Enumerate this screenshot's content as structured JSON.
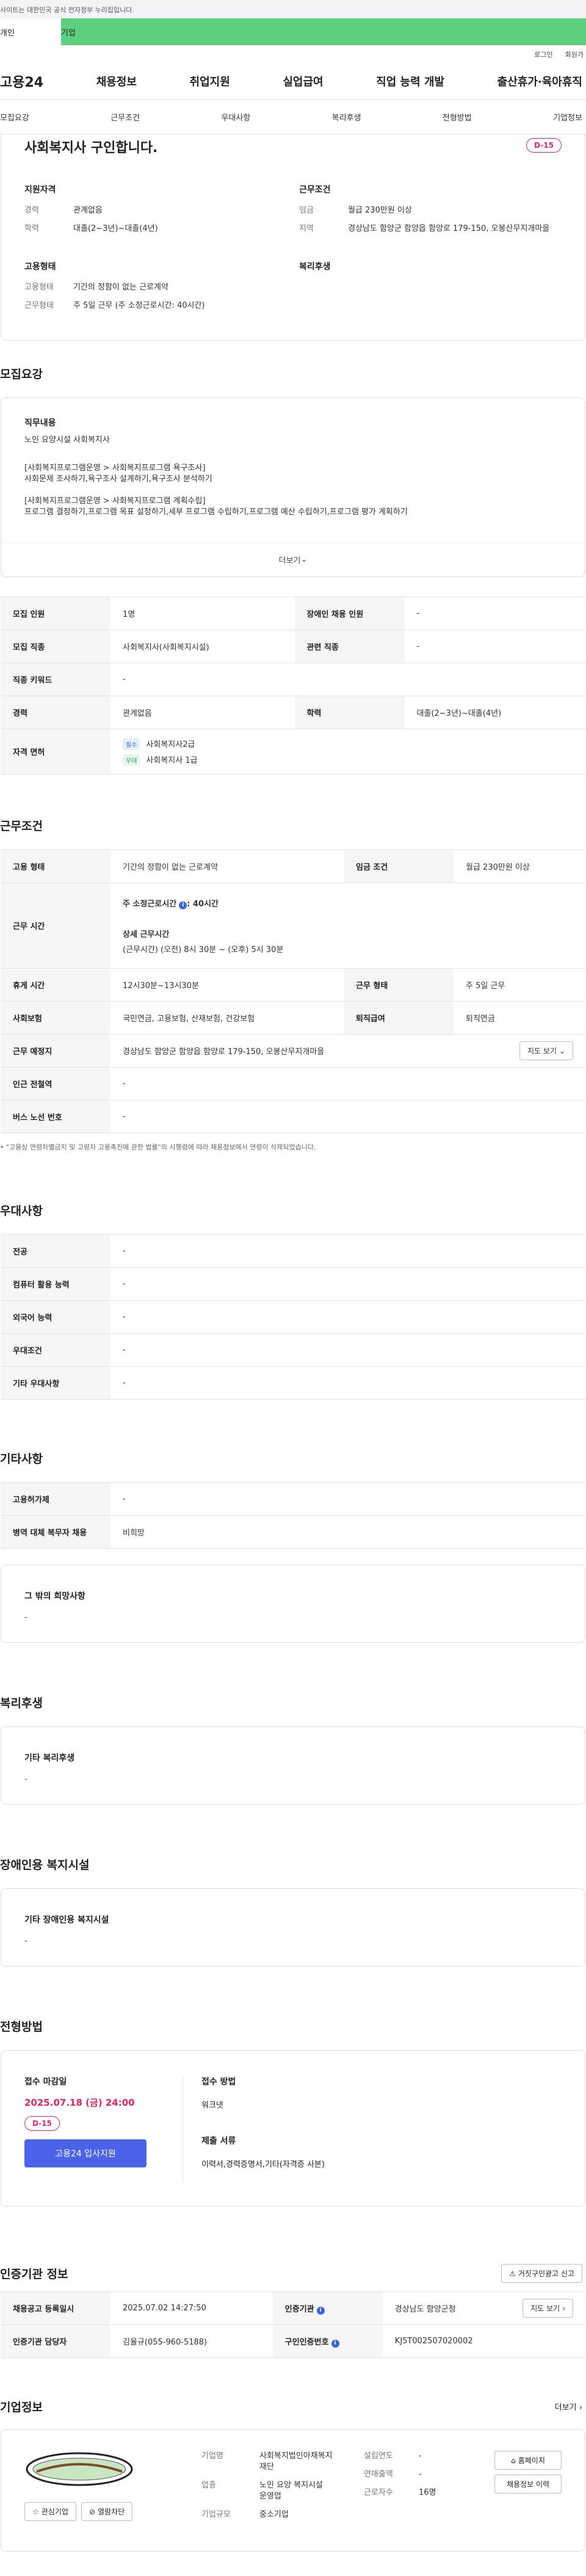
{
  "gov_banner": {
    "text": "사이트는 대한민국 공식 전자정부 누리집입니다."
  },
  "roles": {
    "personal": "개인",
    "business": "기업"
  },
  "util": {
    "login": "로그인",
    "join": "회원가"
  },
  "gnb": {
    "logo": "고용24",
    "menu": [
      "채용정보",
      "취업지원",
      "실업급여",
      "직업 능력 개발",
      "출산휴가·육아휴직"
    ]
  },
  "subnav": [
    "모집요강",
    "근무조건",
    "우대사항",
    "복리후생",
    "전형방법",
    "기업정보"
  ],
  "summary": {
    "title": "사회복지사 구인합니다.",
    "dday": "D-15",
    "qual_h": "지원자격",
    "career_k": "경력",
    "career_v": "관계없음",
    "edu_k": "학력",
    "edu_v": "대졸(2~3년)~대졸(4년)",
    "cond_h": "근무조건",
    "wage_k": "임금",
    "wage_v": "월급 230만원 이상",
    "region_k": "지역",
    "region_v": "경상남도 함양군 함양읍 함양로 179-150, 오봉산무지개마을",
    "emp_h": "고용형태",
    "emptype_k": "고용형태",
    "emptype_v": "기간의 정함이 없는 근로계약",
    "worktype_k": "근무형태",
    "worktype_v": "주 5일 근무 (주 소정근로시간: 40시간)",
    "welfare_h": "복리후생"
  },
  "recruit": {
    "title": "모집요강",
    "duty_h": "직무내용",
    "duty_lines": [
      "노인 요양시설 사회복지사",
      "",
      "[사회복지프로그램운영 > 사회복지프로그램 욕구조사]",
      "사회문제 조사하기,욕구조사 설계하기,욕구조사 분석하기",
      "",
      "[사회복지프로그램운영 > 사회복지프로그램 계획수립]",
      "프로그램 결정하기,프로그램 목표 설정하기,세부 프로그램 수립하기,프로그램 예산 수립하기,프로그램 평가 계획하기"
    ],
    "more": "더보기",
    "rows": {
      "headcount_k": "모집 인원",
      "headcount_v": "1명",
      "disabled_k": "장애인 채용 인원",
      "disabled_v": "-",
      "job_k": "모집 직종",
      "job_v": "사회복지사(사회복지시설)",
      "related_k": "관련 직종",
      "related_v": "-",
      "keyword_k": "직종 키워드",
      "keyword_v": "-",
      "career_k": "경력",
      "career_v": "관계없음",
      "edu_k": "학력",
      "edu_v": "대졸(2~3년)~대졸(4년)",
      "license_k": "자격 면허",
      "license_req_tag": "필수",
      "license_req": "사회복지사2급",
      "license_pref_tag": "우대",
      "license_pref": "사회복지사 1급"
    }
  },
  "conditions": {
    "title": "근무조건",
    "emptype_k": "고용 형태",
    "emptype_v": "기간의 정함이 없는 근로계약",
    "wage_k": "임금 조건",
    "wage_v": "월급 230만원 이상",
    "hours_k": "근무 시간",
    "hours_week": "주 소정근로시간",
    "hours_week_v": ": 40시간",
    "hours_detail_h": "상세 근무시간",
    "hours_detail_v": "(근무시간) (오전) 8시 30분 ~ (오후) 5시 30분",
    "break_k": "휴게 시간",
    "break_v": "12시30분~13시30분",
    "form_k": "근무 형태",
    "form_v": "주 5일 근무",
    "insurance_k": "사회보험",
    "insurance_v": "국민연금, 고용보험, 산재보험, 건강보험",
    "retire_k": "퇴직급여",
    "retire_v": "퇴직연금",
    "place_k": "근무 예정지",
    "place_v": "경상남도 함양군 함양읍 함양로 179-150, 오봉산무지개마을",
    "map_btn": "지도 보기",
    "subway_k": "인근 전철역",
    "subway_v": "-",
    "bus_k": "버스 노선 번호",
    "bus_v": "-",
    "note": "\"고용상 연령차별금지 및 고령자 고용촉진에 관한 법률\"의 시행령에 따라 채용정보에서 연령이 삭제되었습니다."
  },
  "preference": {
    "title": "우대사항",
    "rows": [
      {
        "k": "전공",
        "v": "-"
      },
      {
        "k": "컴퓨터 활용 능력",
        "v": "-"
      },
      {
        "k": "외국어 능력",
        "v": "-"
      },
      {
        "k": "우대조건",
        "v": "-"
      },
      {
        "k": "기타 우대사항",
        "v": "-"
      }
    ]
  },
  "etc": {
    "title": "기타사항",
    "rows": [
      {
        "k": "고용허가제",
        "v": "-"
      },
      {
        "k": "병역 대체 복무자 채용",
        "v": "비희망"
      }
    ],
    "hope_h": "그 밖의 희망사항",
    "hope_v": "-"
  },
  "welfare": {
    "title": "복리후생",
    "h": "기타 복리후생",
    "v": "-"
  },
  "facility": {
    "title": "장애인용 복지시설",
    "h": "기타 장애인용 복지시설",
    "v": "-"
  },
  "selection": {
    "title": "전형방법",
    "deadline_h": "접수 마감일",
    "deadline_v": "2025.07.18 (금) 24:00",
    "dday": "D-15",
    "apply_btn": "고용24 입사지원",
    "method_h": "접수 방법",
    "method_v": "워크넷",
    "docs_h": "제출 서류",
    "docs_v": "이력서,경력증명서,기타(자격증 사본)"
  },
  "certifier": {
    "title": "인증기관 정보",
    "report_btn": "거짓구인광고 신고",
    "reg_k": "채용공고 등록일시",
    "reg_v": "2025.07.02 14:27:50",
    "org_k": "인증기관",
    "org_v": "경상남도 함양군청",
    "map_btn": "지도 보기",
    "manager_k": "인증기관 담당자",
    "manager_v": "김율규(055-960-5188)",
    "authno_k": "구인인증번호",
    "authno_v": "KJ5T002507020002"
  },
  "company": {
    "title": "기업정보",
    "more": "더보기",
    "fav_btn": "관심기업",
    "block_btn": "열람차단",
    "name_k": "기업명",
    "name_v": "사회복지법인아채복지재단",
    "biz_k": "업종",
    "biz_v": "노인 요양 복지시설 운영업",
    "size_k": "기업규모",
    "size_v": "중소기업",
    "founded_k": "설립연도",
    "founded_v": "-",
    "sales_k": "연매출액",
    "sales_v": "-",
    "staff_k": "근로자수",
    "staff_v": "16명",
    "home_btn": "홈페이지",
    "jobs_btn": "채용정보 이력"
  }
}
